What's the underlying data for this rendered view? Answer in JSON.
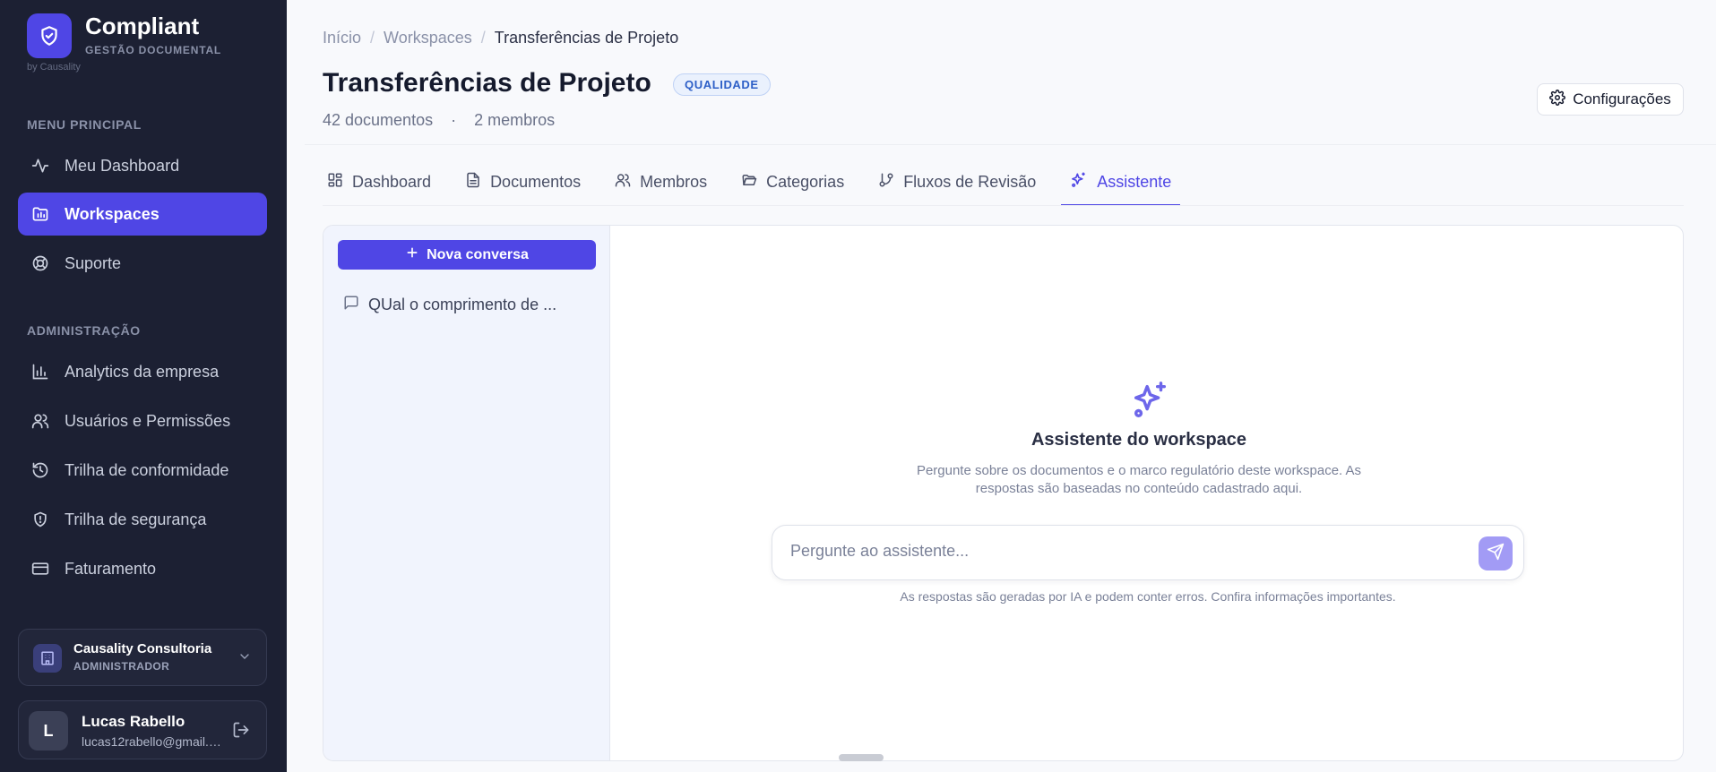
{
  "brand": {
    "name": "Compliant",
    "subtitle": "GESTÃO DOCUMENTAL",
    "by": "by Causality"
  },
  "sidebar": {
    "main_section_label": "MENU PRINCIPAL",
    "main_items": [
      {
        "label": "Meu Dashboard",
        "icon": "activity-icon"
      },
      {
        "label": "Workspaces",
        "icon": "workspaces-icon",
        "active": true
      },
      {
        "label": "Suporte",
        "icon": "lifebuoy-icon"
      }
    ],
    "admin_section_label": "ADMINISTRAÇÃO",
    "admin_items": [
      {
        "label": "Analytics da empresa",
        "icon": "bar-chart-icon"
      },
      {
        "label": "Usuários e Permissões",
        "icon": "users-icon"
      },
      {
        "label": "Trilha de conformidade",
        "icon": "history-icon"
      },
      {
        "label": "Trilha de segurança",
        "icon": "shield-icon"
      },
      {
        "label": "Faturamento",
        "icon": "credit-card-icon"
      }
    ],
    "org": {
      "name": "Causality Consultoria",
      "role": "ADMINISTRADOR"
    },
    "user": {
      "initial": "L",
      "name": "Lucas Rabello",
      "email": "lucas12rabello@gmail.com"
    }
  },
  "breadcrumb": {
    "home": "Início",
    "sep": "/",
    "workspaces": "Workspaces",
    "current": "Transferências de Projeto"
  },
  "header": {
    "title": "Transferências de Projeto",
    "badge": "QUALIDADE",
    "documents": "42 documentos",
    "dot": "·",
    "members": "2 membros",
    "config_label": "Configurações"
  },
  "tabs": [
    {
      "label": "Dashboard",
      "icon": "grid-icon"
    },
    {
      "label": "Documentos",
      "icon": "file-text-icon"
    },
    {
      "label": "Membros",
      "icon": "users-icon"
    },
    {
      "label": "Categorias",
      "icon": "folder-open-icon"
    },
    {
      "label": "Fluxos de Revisão",
      "icon": "git-branch-icon"
    },
    {
      "label": "Assistente",
      "icon": "sparkles-icon",
      "active": true
    }
  ],
  "assistant": {
    "new_conversation": "Nova conversa",
    "conversations": [
      {
        "title": "QUal o comprimento de ..."
      }
    ],
    "empty_title": "Assistente do workspace",
    "empty_description": "Pergunte sobre os documentos e o marco regulatório deste workspace. As respostas são baseadas no conteúdo cadastrado aqui.",
    "input_placeholder": "Pergunte ao assistente...",
    "input_value": "",
    "disclaimer": "As respostas são geradas por IA e podem conter erros. Confira informações importantes."
  },
  "colors": {
    "accent": "#4f46e5",
    "sidebar_bg": "#1c2033",
    "send_button": "#a29bf5",
    "badge_text": "#2d5fc7"
  }
}
